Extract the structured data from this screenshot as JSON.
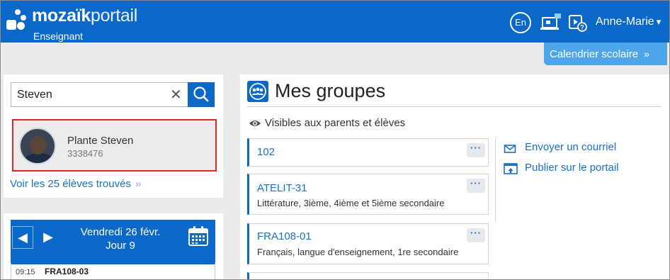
{
  "header": {
    "brand_bold": "mozaïk",
    "brand_light": "portail",
    "role": "Enseignant",
    "lang_button": "En",
    "user_name": "Anne-Marie",
    "user_caret": "▾"
  },
  "calendar_button": {
    "label": "Calendrier scolaire",
    "chevron": "»"
  },
  "search": {
    "value": "Steven",
    "clear_glyph": "✕"
  },
  "result": {
    "name": "Plante Steven",
    "number": "3338476"
  },
  "see_all": {
    "label": "Voir les 25 élèves trouvés",
    "chevron": "»"
  },
  "day": {
    "prev": "◀",
    "next": "▶",
    "date": "Vendredi 26 févr.",
    "day_label": "Jour 9"
  },
  "schedule": {
    "time": "09:15",
    "course": "FRA108-03"
  },
  "main": {
    "title": "Mes groupes",
    "visibility": "Visibles aux parents et élèves",
    "more_glyph": "···",
    "groups": [
      {
        "name": "102",
        "desc": ""
      },
      {
        "name": "ATELIT-31",
        "desc": "Littérature, 3ième, 4ième et 5ième secondaire"
      },
      {
        "name": "FRA108-01",
        "desc": "Français, langue d'enseignement, 1re secondaire"
      }
    ],
    "actions": [
      {
        "label": "Envoyer un courriel",
        "icon": "envelope-icon"
      },
      {
        "label": "Publier sur le portail",
        "icon": "publish-icon"
      }
    ]
  },
  "colors": {
    "brand_blue": "#0a68c9",
    "light_blue": "#4ea6ea",
    "highlight_red": "#d9252c",
    "link_blue": "#1a6fc8"
  }
}
